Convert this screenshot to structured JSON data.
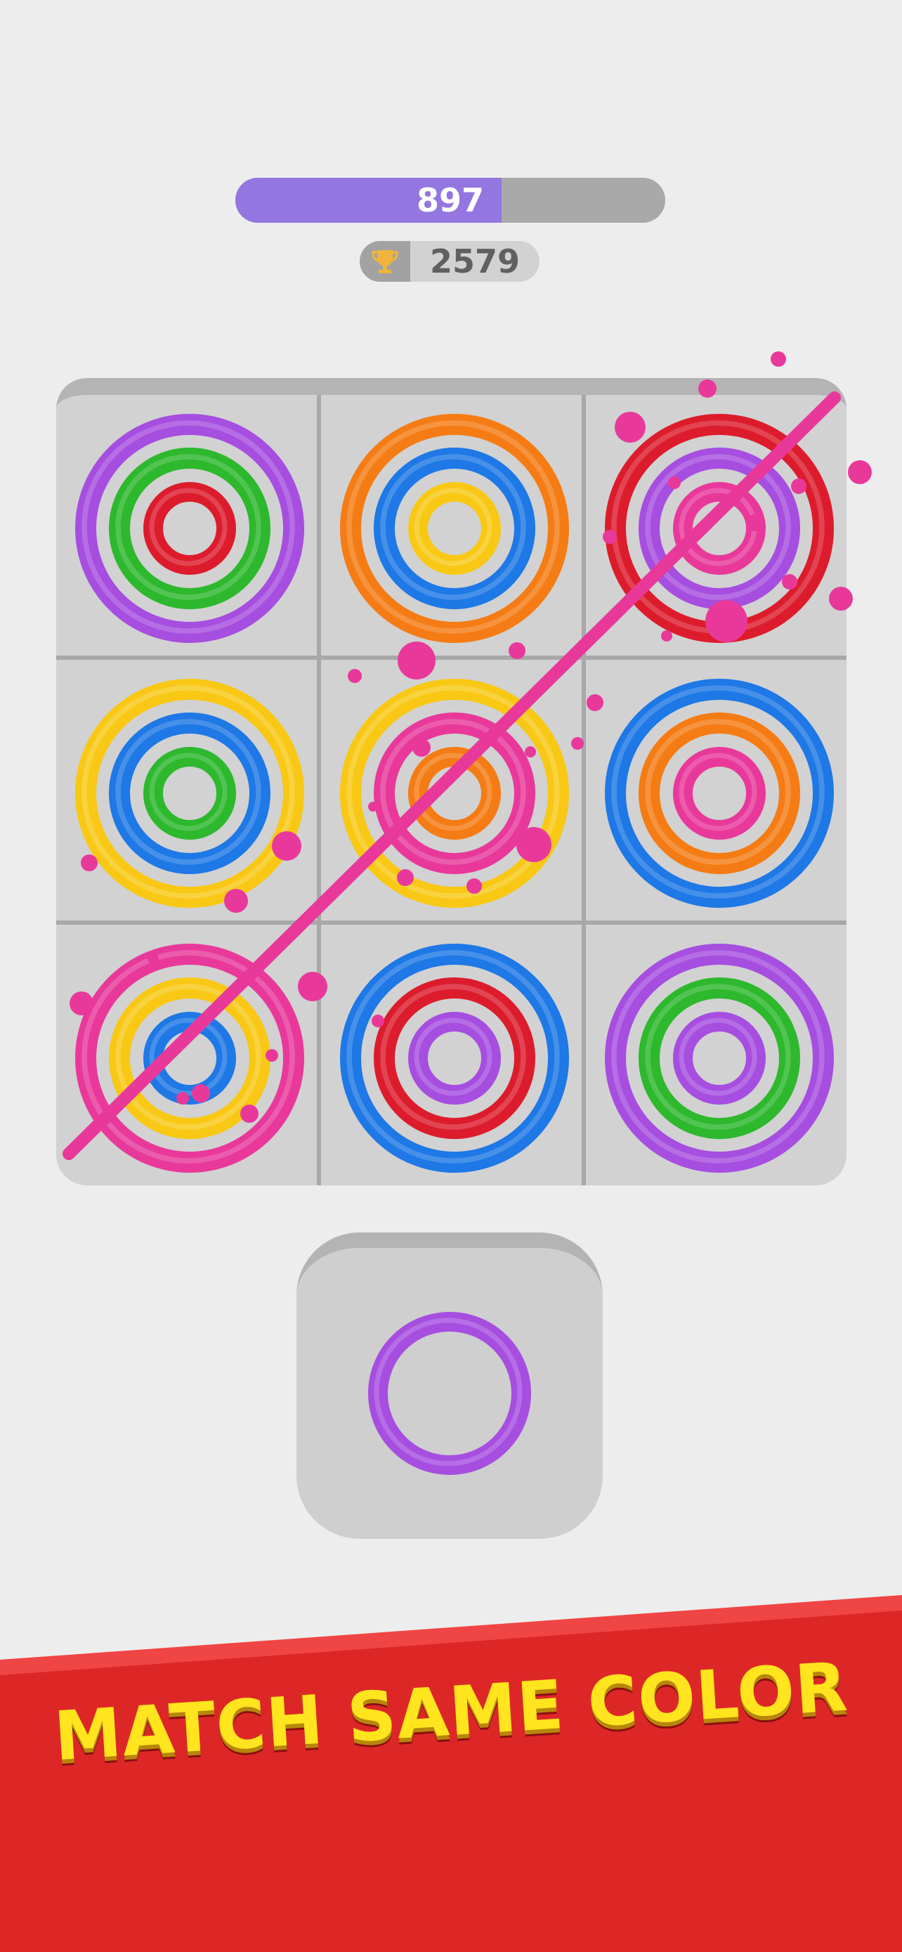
{
  "hud": {
    "score": "897",
    "score_progress": 0.62,
    "best_score": "2579",
    "trophy_icon": "trophy-icon"
  },
  "colors": {
    "purple": "#a64ee0",
    "green": "#2db82d",
    "red": "#dc1c2c",
    "orange": "#f57c14",
    "blue": "#1e78e6",
    "yellow": "#f8c815",
    "pink": "#e8399b",
    "banner_red": "#dd2727",
    "banner_text": "#ffe41e",
    "score_fill": "#9376e0"
  },
  "board": {
    "rows": 3,
    "cols": 3,
    "cells": [
      [
        "purple",
        "green",
        "red"
      ],
      [
        "orange",
        "blue",
        "yellow"
      ],
      [
        "red",
        "purple",
        "pink"
      ],
      [
        "yellow",
        "blue",
        "green"
      ],
      [
        "yellow",
        "pink",
        "orange"
      ],
      [
        "blue",
        "orange",
        "pink"
      ],
      [
        "pink",
        "yellow",
        "blue"
      ],
      [
        "blue",
        "red",
        "purple"
      ],
      [
        "purple",
        "green",
        "purple"
      ]
    ],
    "match_line_color": "pink"
  },
  "next_piece": {
    "size": "large",
    "color": "purple"
  },
  "banner": {
    "text": "MATCH SAME COLOR"
  }
}
